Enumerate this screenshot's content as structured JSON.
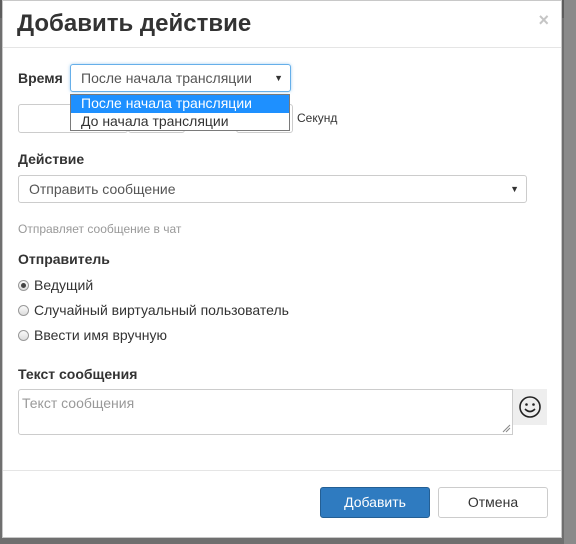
{
  "modal": {
    "title": "Добавить действие",
    "close_symbol": "×"
  },
  "time": {
    "label": "Время",
    "selected": "После начала трансляции",
    "options": [
      "После начала трансляции",
      "До начала трансляции"
    ],
    "unit_label": "Секунд"
  },
  "action": {
    "label": "Действие",
    "selected": "Отправить сообщение",
    "hint": "Отправляет сообщение в чат"
  },
  "sender": {
    "label": "Отправитель",
    "options": [
      {
        "label": "Ведущий",
        "checked": true
      },
      {
        "label": "Случайный виртуальный пользователь",
        "checked": false
      },
      {
        "label": "Ввести имя вручную",
        "checked": false
      }
    ]
  },
  "message": {
    "label": "Текст сообщения",
    "placeholder": "Текст сообщения",
    "emoji_icon": "smiley-icon"
  },
  "footer": {
    "add_label": "Добавить",
    "cancel_label": "Отмена"
  },
  "colors": {
    "primary": "#2f7bc0",
    "dropdown_highlight": "#1e90ff"
  }
}
